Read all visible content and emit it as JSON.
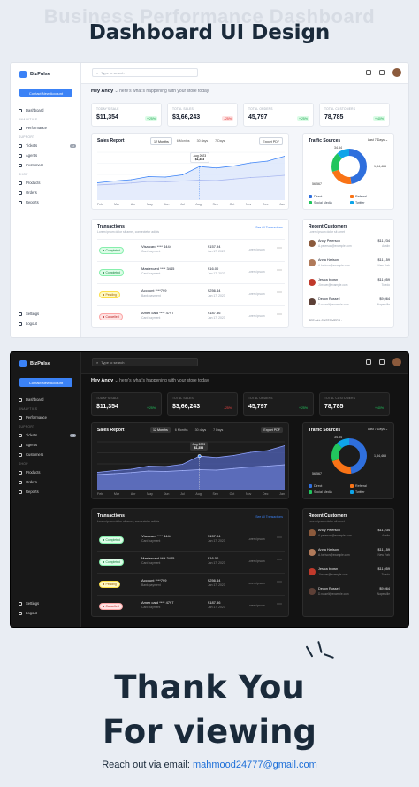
{
  "header": {
    "ghost_title": "Business Performance Dashboard",
    "title": "Dashboard UI Design"
  },
  "app": {
    "brand": "BizPulse",
    "contact_button": "Contact New Account",
    "search_placeholder": "Type to search",
    "greeting_name": "Hey Andy",
    "greeting_sub": "here's what's happening with your store today"
  },
  "sidebar": {
    "items": [
      {
        "label": "Dashboard",
        "icon": "grid-icon"
      },
      {
        "section": "ANALYTICS"
      },
      {
        "label": "Performance",
        "icon": "chart-icon"
      },
      {
        "section": "SUPPORT"
      },
      {
        "label": "Tickets",
        "icon": "ticket-icon",
        "badge": "12"
      },
      {
        "label": "Agents",
        "icon": "user-icon"
      },
      {
        "label": "Customers",
        "icon": "users-icon"
      },
      {
        "section": "SHOP"
      },
      {
        "label": "Products",
        "icon": "box-icon"
      },
      {
        "label": "Orders",
        "icon": "cart-icon"
      },
      {
        "label": "Reports",
        "icon": "report-icon"
      }
    ],
    "bottom": [
      {
        "label": "Settings",
        "icon": "gear-icon"
      },
      {
        "label": "Logout",
        "icon": "logout-icon"
      }
    ]
  },
  "stats": [
    {
      "label": "TODAY'S SALE",
      "value": "$11,354",
      "change": "+ 25%",
      "trend": "up"
    },
    {
      "label": "TOTAL SALES",
      "value": "$3,66,243",
      "change": "- 25%",
      "trend": "down"
    },
    {
      "label": "TOTAL ORDERS",
      "value": "45,797",
      "change": "+ 25%",
      "trend": "up"
    },
    {
      "label": "TOTAL CUSTOMERS",
      "value": "78,785",
      "change": "+ 40%",
      "trend": "up"
    }
  ],
  "sales_report": {
    "title": "Sales Report",
    "tabs": [
      "12 Months",
      "6 Months",
      "30 days",
      "7 Days"
    ],
    "active_tab": 0,
    "export": "Export PDF",
    "tooltip_date": "Aug 2023",
    "tooltip_value": "$1,353",
    "tooltip_index": 6
  },
  "chart_data": {
    "type": "area",
    "title": "Sales Report",
    "categories": [
      "Feb",
      "Mar",
      "Apr",
      "May",
      "Jun",
      "Jul",
      "Aug",
      "Sep",
      "Oct",
      "Nov",
      "Dec",
      "Jan"
    ],
    "series": [
      {
        "values": [
          620,
          700,
          760,
          900,
          880,
          980,
          1353,
          1290,
          1380,
          1520,
          1600,
          1820
        ]
      },
      {
        "values": [
          520,
          560,
          610,
          680,
          660,
          700,
          740,
          720,
          790,
          860,
          900,
          960
        ]
      }
    ],
    "ylim": [
      0,
      2000
    ],
    "colors": [
      "#3b82f6",
      "#c7d2fe"
    ]
  },
  "traffic": {
    "title": "Traffic Sources",
    "range": "Last 7 Days",
    "slices": [
      {
        "name": "Direct",
        "value": "1,34,465",
        "color": "#2f6fdd",
        "pct": 48
      },
      {
        "name": "Referral",
        "value": "34.54",
        "color": "#f97316",
        "pct": 22
      },
      {
        "name": "Social Media",
        "value": "56.567",
        "color": "#22c55e",
        "pct": 18
      },
      {
        "name": "Twitter",
        "value": "",
        "color": "#0ea5e9",
        "pct": 12
      }
    ]
  },
  "transactions": {
    "title": "Transactions",
    "subtitle": "Lorem ipsum dolor sit amet, consectetur adipis",
    "see_all": "See All Transactions",
    "rows": [
      {
        "status": "Completed",
        "status_class": "st-completed",
        "method": "Visa card **** 4444",
        "type": "Card payment",
        "amount": "$157.94",
        "date": "Jan 17, 2023",
        "desc": "Lorem ipsum"
      },
      {
        "status": "Completed",
        "status_class": "st-completed",
        "method": "Mastercard **** 3445",
        "type": "Card payment",
        "amount": "$16.00",
        "date": "Jan 17, 2023",
        "desc": "Lorem ipsum"
      },
      {
        "status": "Pending",
        "status_class": "st-pending",
        "method": "Account ****799",
        "type": "Bank payment",
        "amount": "$256.44",
        "date": "Jan 17, 2023",
        "desc": "Lorem ipsum"
      },
      {
        "status": "Cancelled",
        "status_class": "st-cancelled",
        "method": "Amex card **** 4797",
        "type": "Card payment",
        "amount": "$187.56",
        "date": "Jan 17, 2023",
        "desc": "Lorem ipsum"
      }
    ]
  },
  "recent_customers": {
    "title": "Recent Customers",
    "subtitle": "Lorem ipsum dolor sit amet",
    "see_all": "SEE ALL CUSTOMERS",
    "rows": [
      {
        "name": "Andy Peterson",
        "email": "A.peterson@example.com",
        "amount": "$11,234",
        "city": "Austin",
        "color": "#8b5a3c"
      },
      {
        "name": "Anna Harison",
        "email": "A.harison@example.com",
        "amount": "$11,159",
        "city": "New York",
        "color": "#b07a5a"
      },
      {
        "name": "Jesica brown",
        "email": "J.brown@example.com",
        "amount": "$11,059",
        "city": "Toledo",
        "color": "#c0392b"
      },
      {
        "name": "Devon Russell",
        "email": "D.russell@example.com",
        "amount": "$9,064",
        "city": "Naperville",
        "color": "#5d4037"
      }
    ]
  },
  "footer": {
    "thanks_line1": "Thank You",
    "thanks_line2": "For viewing",
    "reach_label": "Reach out via email:",
    "email": "mahmood24777@gmail.com"
  }
}
